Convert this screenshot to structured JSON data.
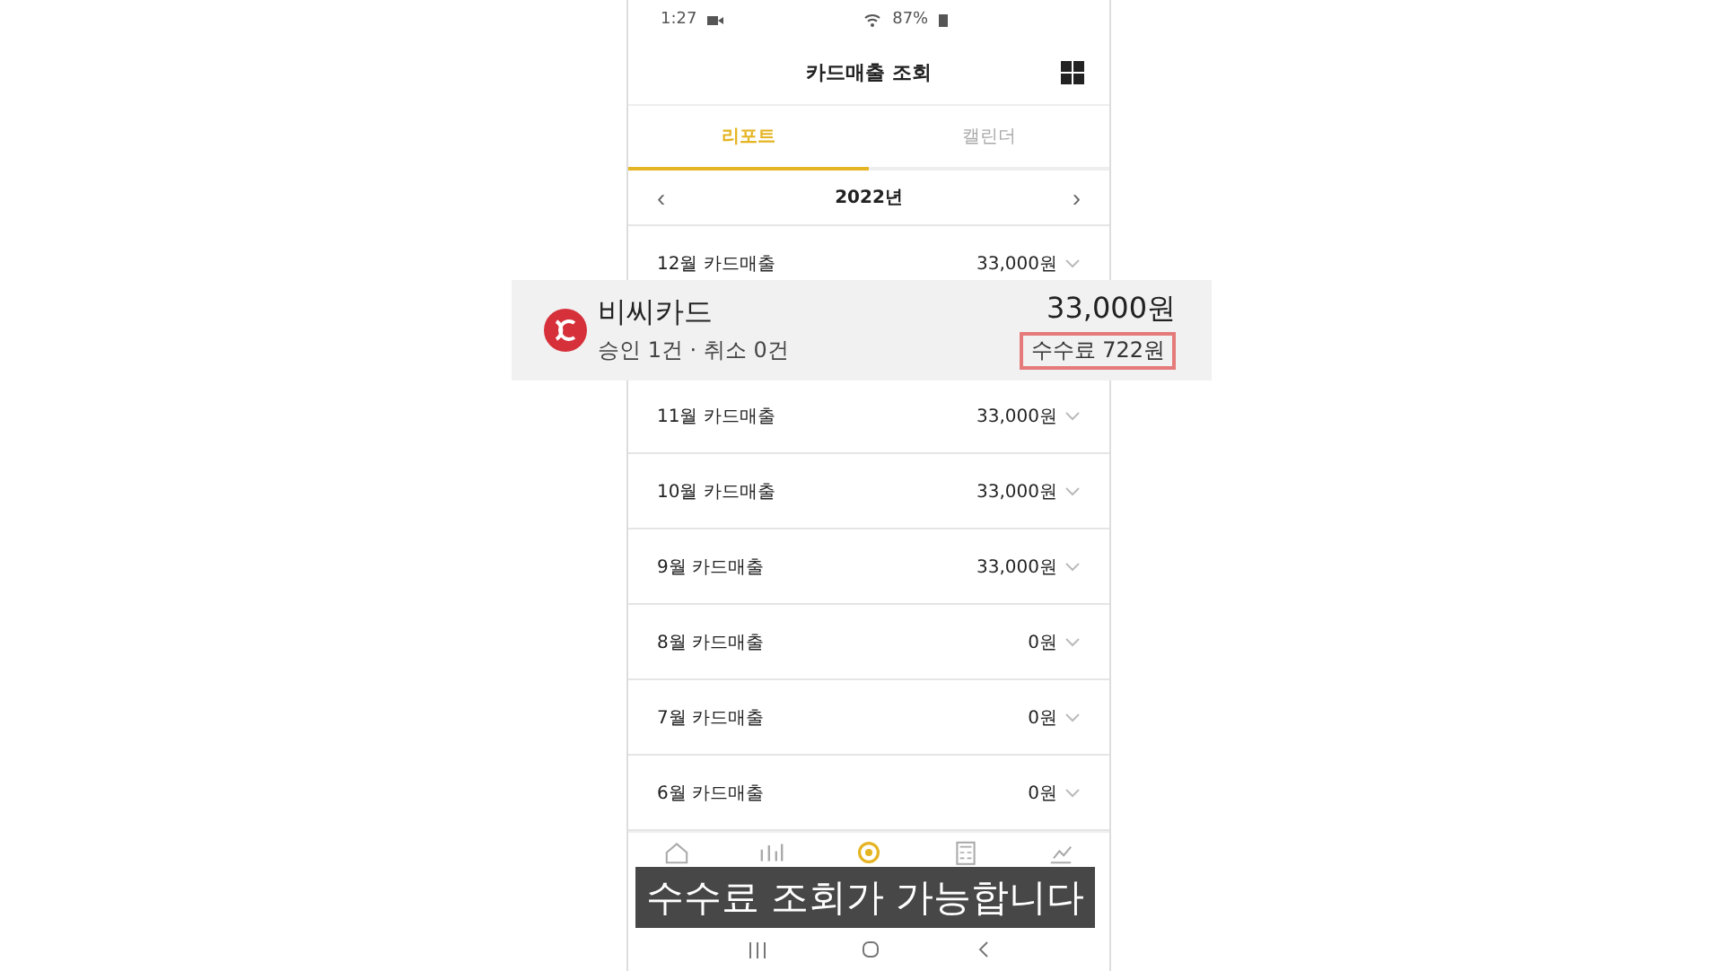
{
  "status_bar": {
    "time": "1:27",
    "battery": "87%"
  },
  "header": {
    "title": "카드매출 조회"
  },
  "tabs": [
    {
      "label": "리포트",
      "selected": true
    },
    {
      "label": "캘린더",
      "selected": false
    }
  ],
  "year_nav": {
    "prev": "‹",
    "year": "2022년",
    "next": "›"
  },
  "months": [
    {
      "label": "12월 카드매출",
      "amount": "33,000원",
      "expanded": true
    },
    {
      "label": "11월 카드매출",
      "amount": "33,000원",
      "expanded": false
    },
    {
      "label": "10월 카드매출",
      "amount": "33,000원",
      "expanded": false
    },
    {
      "label": "9월 카드매출",
      "amount": "33,000원",
      "expanded": false
    },
    {
      "label": "8월 카드매출",
      "amount": "0원",
      "expanded": false
    },
    {
      "label": "7월 카드매출",
      "amount": "0원",
      "expanded": false
    },
    {
      "label": "6월 카드매출",
      "amount": "0원",
      "expanded": false
    }
  ],
  "card_detail": {
    "name": "비씨카드",
    "counts": "승인 1건 · 취소 0건",
    "amount": "33,000원",
    "fee": "수수료 722원"
  },
  "bottom_nav": [
    {
      "kind": "home",
      "selected": false
    },
    {
      "kind": "chart",
      "selected": false
    },
    {
      "kind": "coin",
      "selected": true
    },
    {
      "kind": "calculator",
      "selected": false
    },
    {
      "kind": "growth",
      "selected": false
    }
  ],
  "caption": "수수료 조회가 가능합니다"
}
